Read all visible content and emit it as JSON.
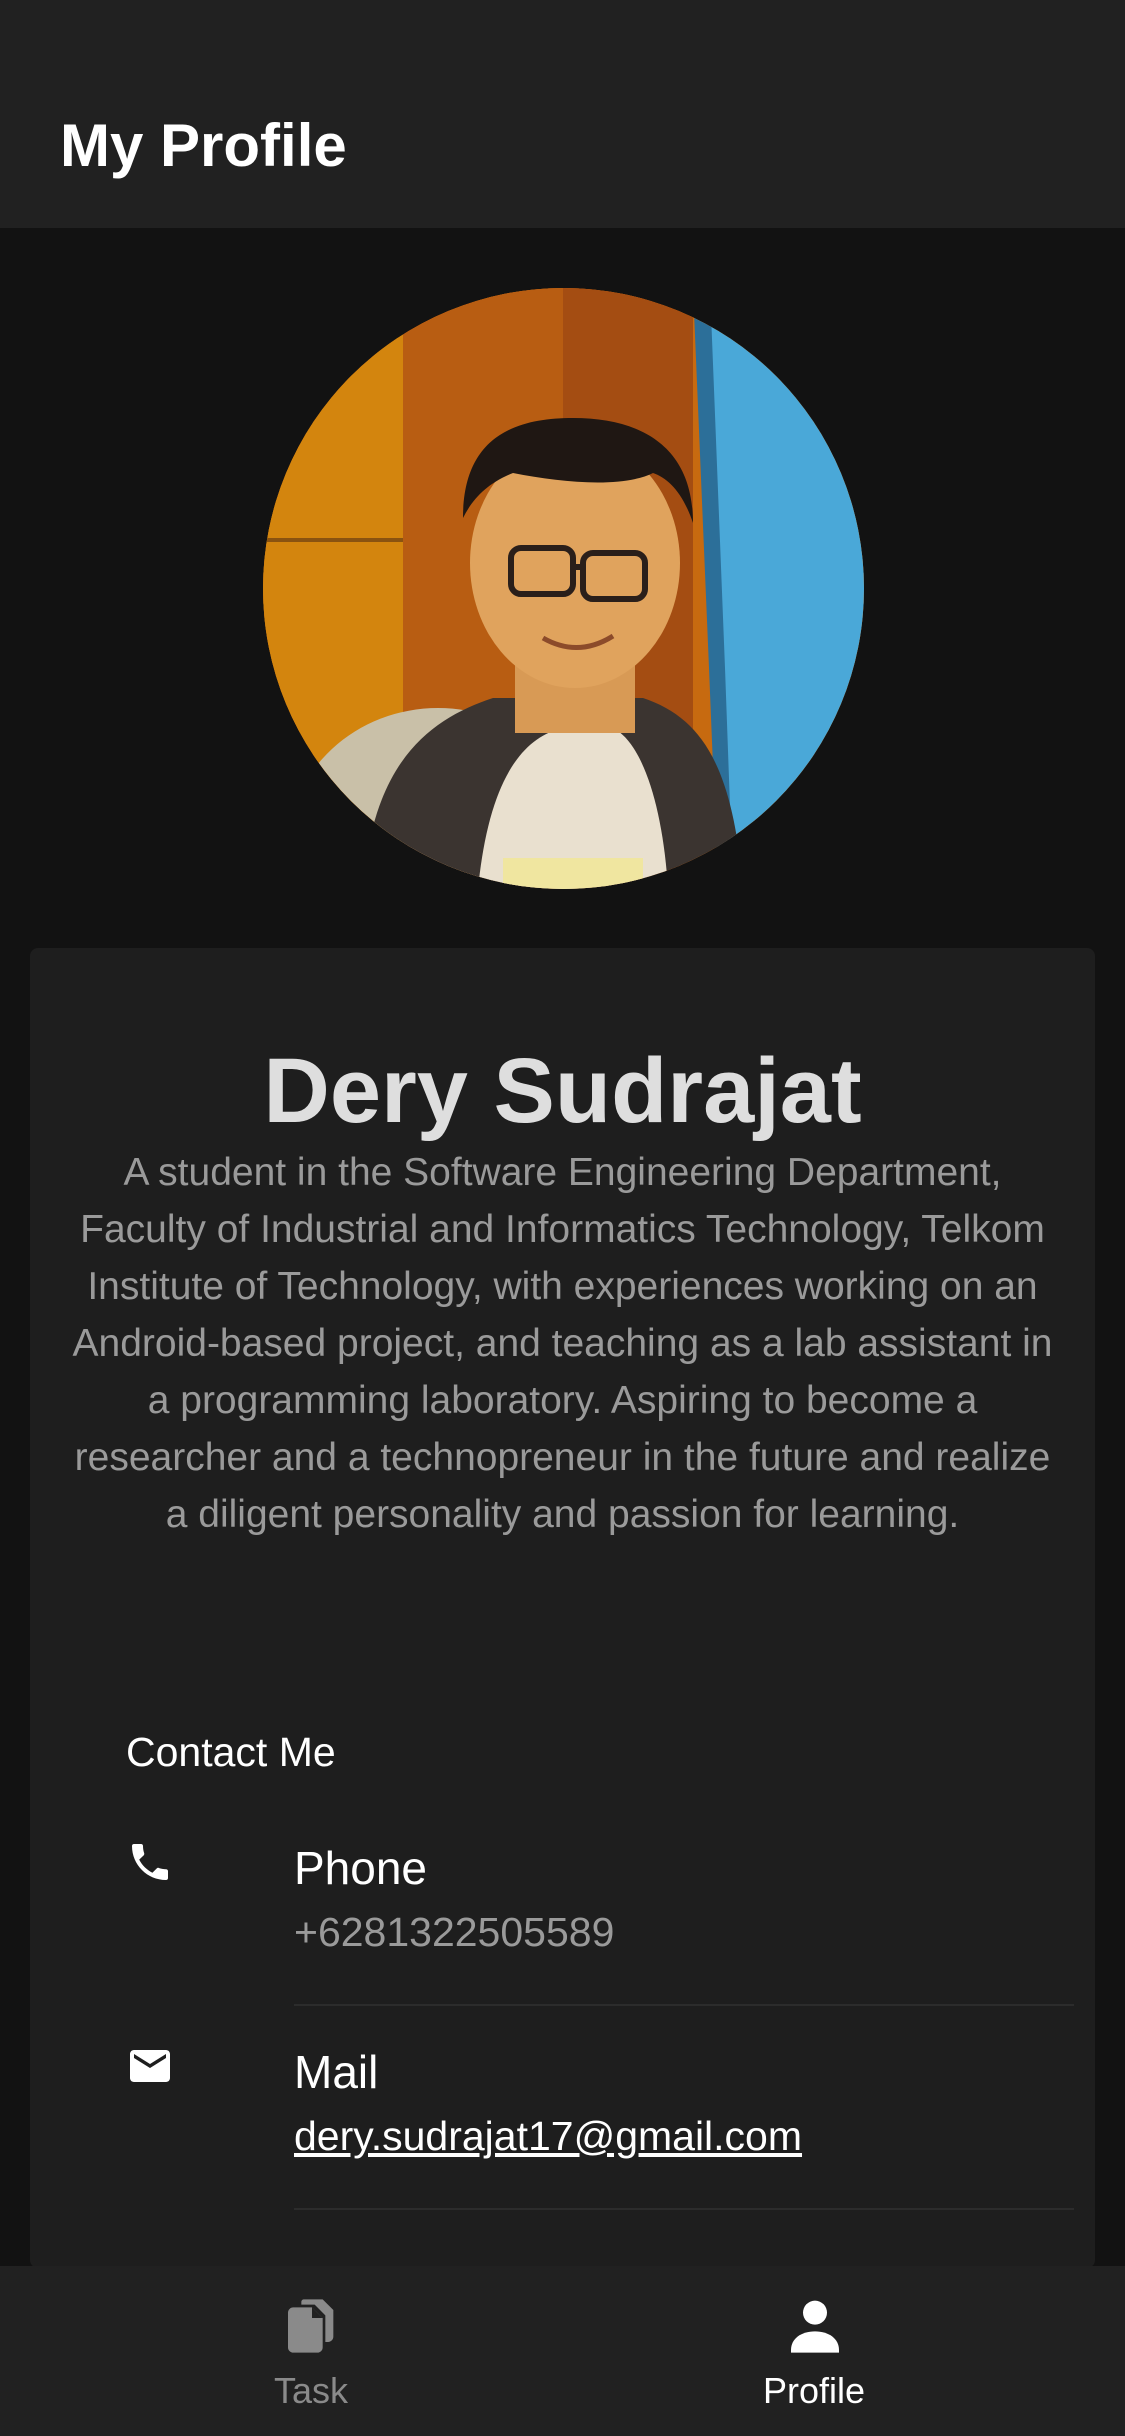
{
  "app_bar": {
    "title": "My Profile"
  },
  "profile": {
    "avatar": "profile-photo",
    "name": "Dery Sudrajat",
    "bio": "A student in the Software Engineering Department, Faculty of Industrial and Informatics Technology, Telkom Institute of Technology, with experiences working on an Android-based project, and teaching as a lab assistant in a programming laboratory. Aspiring to become a researcher and a technopreneur in the future and realize a diligent personality and passion for learning."
  },
  "contact": {
    "section_title": "Contact Me",
    "items": [
      {
        "icon": "phone-icon",
        "label": "Phone",
        "value": "+6281322505589"
      },
      {
        "icon": "mail-icon",
        "label": "Mail",
        "value": "dery.sudrajat17@gmail.com"
      }
    ]
  },
  "bottom_nav": {
    "items": [
      {
        "icon": "task-icon",
        "label": "Task",
        "active": false
      },
      {
        "icon": "profile-icon",
        "label": "Profile",
        "active": true
      }
    ]
  },
  "colors": {
    "app_bar": "#212121",
    "background": "#121212",
    "card": "#1e1e1e",
    "secondary_text": "#9a9a9a",
    "inactive_nav": "#8a8a8a"
  }
}
